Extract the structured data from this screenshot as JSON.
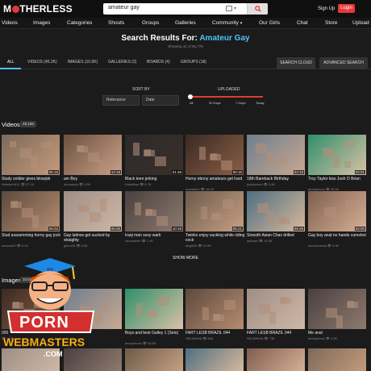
{
  "header": {
    "logo": "MOTHERLESS",
    "search_value": "amateur gay",
    "signup": "Sign Up",
    "login": "Login"
  },
  "nav": [
    "Videos",
    "Images",
    "Categories",
    "Shouts",
    "Groups",
    "Galleries",
    "Community",
    "Our Girls",
    "Chat",
    "Store",
    "Upload"
  ],
  "results": {
    "prefix": "Search Results For:",
    "query": "Amateur Gay",
    "subtitle": "Showing 42 of 55,775"
  },
  "tabs": [
    "ALL",
    "VIDEOS (45.2K)",
    "IMAGES (10.5K)",
    "GALLERIES (2)",
    "BOARDS (4)",
    "GROUPS (18)"
  ],
  "buttons": {
    "search_cloud": "SEARCH CLOUD",
    "advanced": "ADVANCED SEARCH"
  },
  "sort": {
    "label": "SORT BY",
    "options": [
      "Relevance",
      "Date"
    ]
  },
  "uploaded": {
    "label": "UPLOADED",
    "stops": [
      "All",
      "30 Days",
      "7 Days",
      "Today"
    ]
  },
  "videos": {
    "heading": "Videos",
    "count": "45,159",
    "row1": [
      {
        "title": "Study soldier gives blowjob",
        "user": "Winston4111",
        "views": "37.1K",
        "dur": "06:15"
      },
      {
        "title": "am Boy",
        "user": "doomdork",
        "views": "2.5K",
        "dur": "10:19"
      },
      {
        "title": "Black teen jerking",
        "user": "DidieBlue",
        "views": "6.7K",
        "dur": "01:49"
      },
      {
        "title": "Horny ebony amateurs get hard",
        "user": "menefuk1",
        "views": "18.1K",
        "dur": "00:15"
      },
      {
        "title": "18th Bareback Birthday",
        "user": "juicyredrod",
        "views": "3.2K",
        "dur": "03:10"
      },
      {
        "title": "Troy Taylor kiss Josh O Brian",
        "user": "anonymous",
        "views": "20.2K",
        "dur": "03:01"
      }
    ],
    "row2": [
      {
        "title": "Stud asaramming horny gay jock",
        "user": "marcus20",
        "views": "9.1K",
        "dur": "06:02"
      },
      {
        "title": "Gay latinos get sucked by straighty",
        "user": "glenn25",
        "views": "6.9K",
        "dur": "06:00"
      },
      {
        "title": "Iraqi man sexy wark",
        "user": "zoomodein",
        "views": "1.1K",
        "dur": "10:19"
      },
      {
        "title": "Twinks enjoy sucking while riding cock",
        "user": "angie00",
        "views": "10.9K",
        "dur": "05:21"
      },
      {
        "title": "Smooth Asian Chav drilled",
        "user": "assbast",
        "views": "10.5K",
        "dur": "09:29"
      },
      {
        "title": "Gay boy anal no hands cumshot",
        "user": "wooworooda",
        "views": "4.3K",
        "dur": "03:00"
      }
    ],
    "show_more": "SHOW MORE"
  },
  "images": {
    "heading": "Images",
    "count": "10,539",
    "row1": [
      {
        "title": "000",
        "user": "",
        "views": "1.2K"
      },
      {
        "title": "",
        "user": "",
        "views": ""
      },
      {
        "title": "Boys and best Galley 1 (Sets)",
        "user": "anonymous",
        "views": "46.5K"
      },
      {
        "title": "FART LESB BRAZIL 044",
        "user": "SELMINHA",
        "views": "665"
      },
      {
        "title": "FART LESB BRAZIL 044",
        "user": "SELMINHA",
        "views": "738"
      },
      {
        "title": "Me anal",
        "user": "anonymous",
        "views": "4.3K"
      }
    ]
  },
  "watermark": {
    "line1": "PORN",
    "line2": "WEBMASTERS",
    "line3": ".COM"
  }
}
